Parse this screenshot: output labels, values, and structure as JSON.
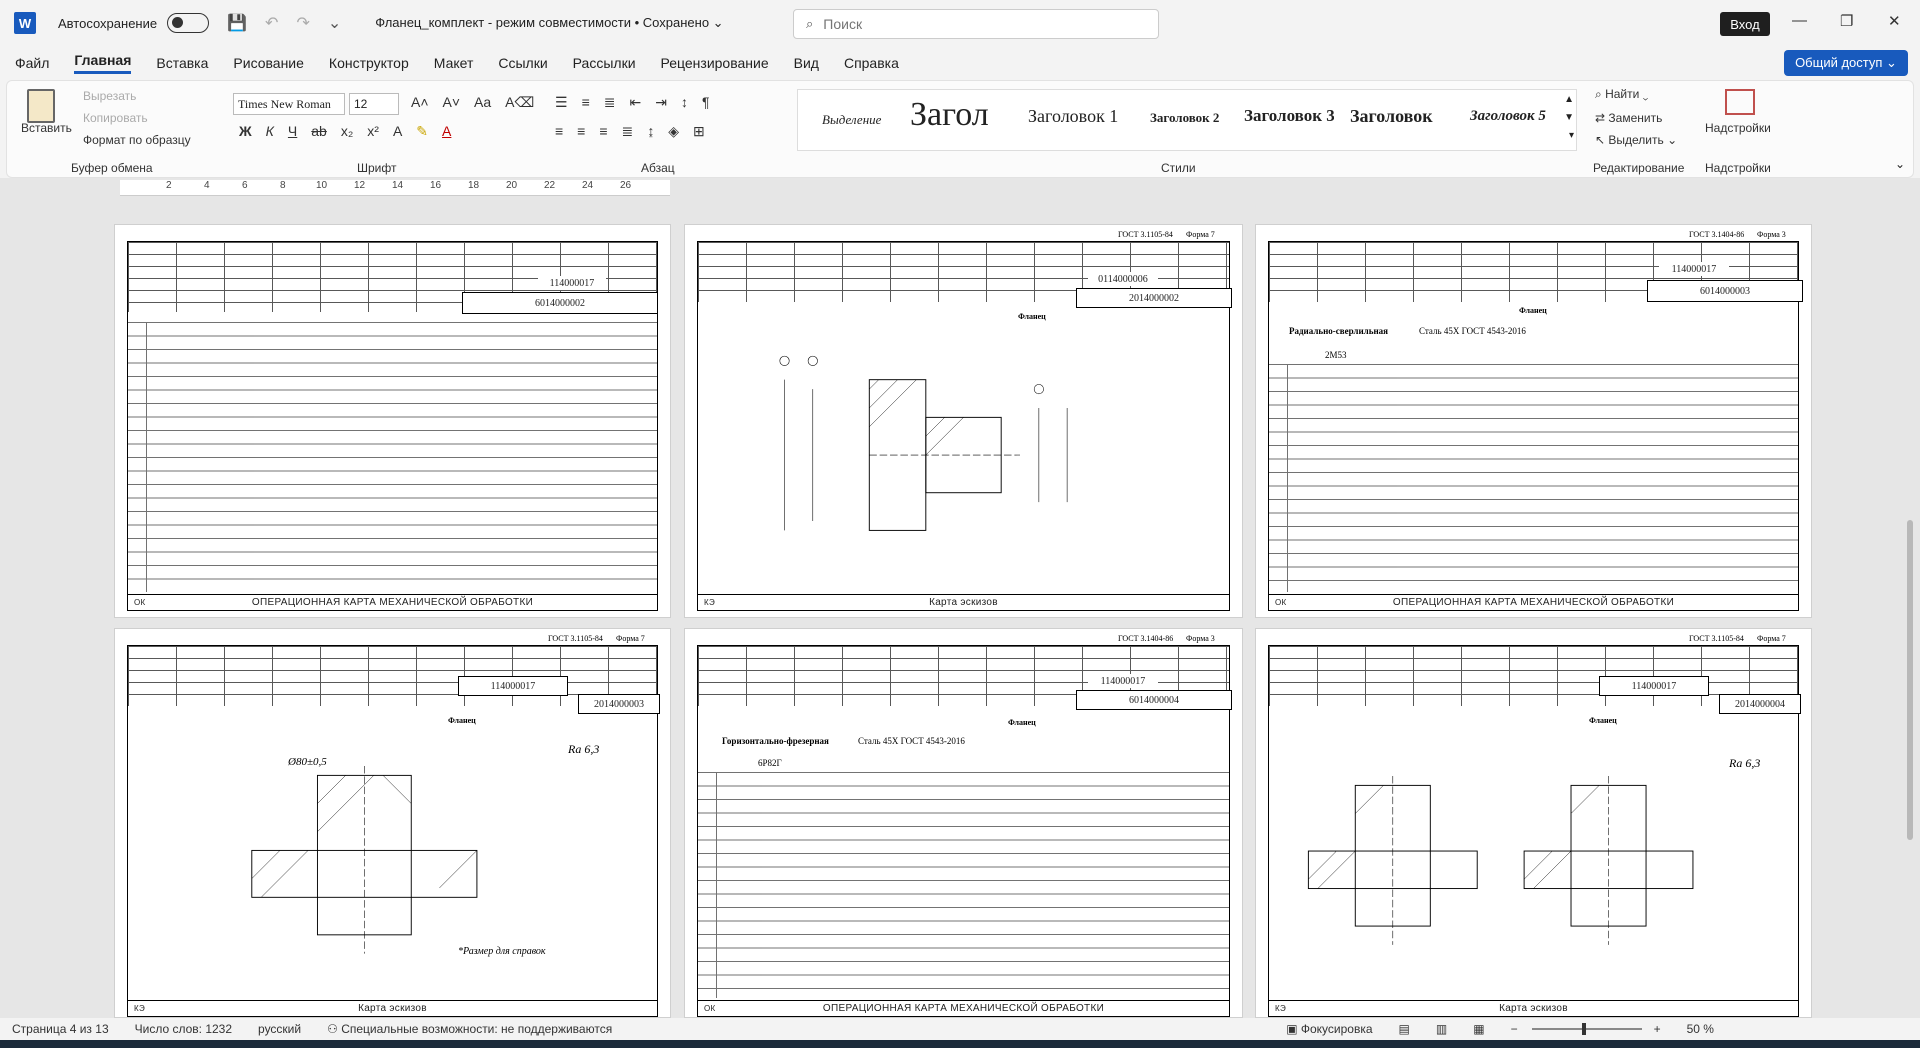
{
  "titlebar": {
    "app_letter": "W",
    "autosave_label": "Автосохранение",
    "doc_title": "Фланец_комплект  -  режим совместимости • Сохранено ⌄",
    "search_placeholder": "Поиск",
    "login": "Вход"
  },
  "menu": [
    "Файл",
    "Главная",
    "Вставка",
    "Рисование",
    "Конструктор",
    "Макет",
    "Ссылки",
    "Рассылки",
    "Рецензирование",
    "Вид",
    "Справка"
  ],
  "share_label": "Общий доступ ⌄",
  "ribbon": {
    "clipboard": {
      "paste": "Вставить",
      "cut": "Вырезать",
      "copy": "Копировать",
      "format_painter": "Формат по образцу",
      "group": "Буфер обмена"
    },
    "font": {
      "name": "Times New Roman",
      "size": "12",
      "group": "Шрифт"
    },
    "paragraph": {
      "group": "Абзац"
    },
    "styles": {
      "items": [
        "Выделение",
        "Загол",
        "Заголовок 1",
        "Заголовок 2",
        "Заголовок 3",
        "Заголовок",
        "Заголовок 5"
      ],
      "group": "Стили"
    },
    "editing": {
      "find": "Найти",
      "replace": "Заменить",
      "select": "Выделить",
      "group": "Редактирование"
    },
    "addins": {
      "label": "Надстройки",
      "group": "Надстройки"
    }
  },
  "ruler": [
    "2",
    "4",
    "6",
    "8",
    "10",
    "12",
    "14",
    "16",
    "18",
    "20",
    "22",
    "24",
    "26"
  ],
  "pages": [
    {
      "code_left": "114000017",
      "code_right": "6014000002",
      "title": "ОПЕРАЦИОННАЯ КАРТА МЕХАНИЧЕСКОЙ ОБРАБОТКИ",
      "kind": "card",
      "ok": "ОК"
    },
    {
      "gost": "ГОСТ 3.1105-84",
      "form": "Форма 7",
      "code_left": "0114000006",
      "code_right": "2014000002",
      "part": "Фланец",
      "title": "Карта эскизов",
      "kind": "sketch",
      "ok": "КЭ"
    },
    {
      "gost": "ГОСТ 3.1404-86",
      "form": "Форма 3",
      "code_left": "114000017",
      "code_right": "6014000003",
      "part": "Фланец",
      "operation": "Радиально-сверлильная",
      "material": "Сталь 45Х ГОСТ 4543-2016",
      "machine": "2М53",
      "title": "ОПЕРАЦИОННАЯ КАРТА МЕХАНИЧЕСКОЙ ОБРАБОТКИ",
      "kind": "card",
      "ok": "ОК"
    },
    {
      "gost": "ГОСТ 3.1105-84",
      "form": "Форма 7",
      "code_left": "114000017",
      "code_right": "2014000003",
      "part": "Фланец",
      "title": "Карта эскизов",
      "kind": "sketch",
      "ok": "КЭ",
      "note": "*Размер для справок",
      "dim_top": "Ø80±0,5",
      "ra": "Ra 6,3"
    },
    {
      "gost": "ГОСТ 3.1404-86",
      "form": "Форма 3",
      "code_left": "114000017",
      "code_right": "6014000004",
      "part": "Фланец",
      "operation": "Горизонтально-фрезерная",
      "material": "Сталь 45Х ГОСТ 4543-2016",
      "machine": "6Р82Г",
      "title": "ОПЕРАЦИОННАЯ КАРТА МЕХАНИЧЕСКОЙ ОБРАБОТКИ",
      "kind": "card",
      "ok": "ОК"
    },
    {
      "gost": "ГОСТ 3.1105-84",
      "form": "Форма 7",
      "code_left": "114000017",
      "code_right": "2014000004",
      "part": "Фланец",
      "title": "Карта эскизов",
      "kind": "sketch",
      "ok": "КЭ",
      "ra": "Ra 6,3"
    }
  ],
  "status": {
    "page": "Страница 4 из 13",
    "words": "Число слов: 1232",
    "lang": "русский",
    "accessibility": "Специальные возможности: не поддерживаются",
    "focus": "Фокусировка",
    "zoom": "50 %"
  },
  "colors": {
    "accent": "#185abd",
    "canvas": "#e6e6e6"
  }
}
